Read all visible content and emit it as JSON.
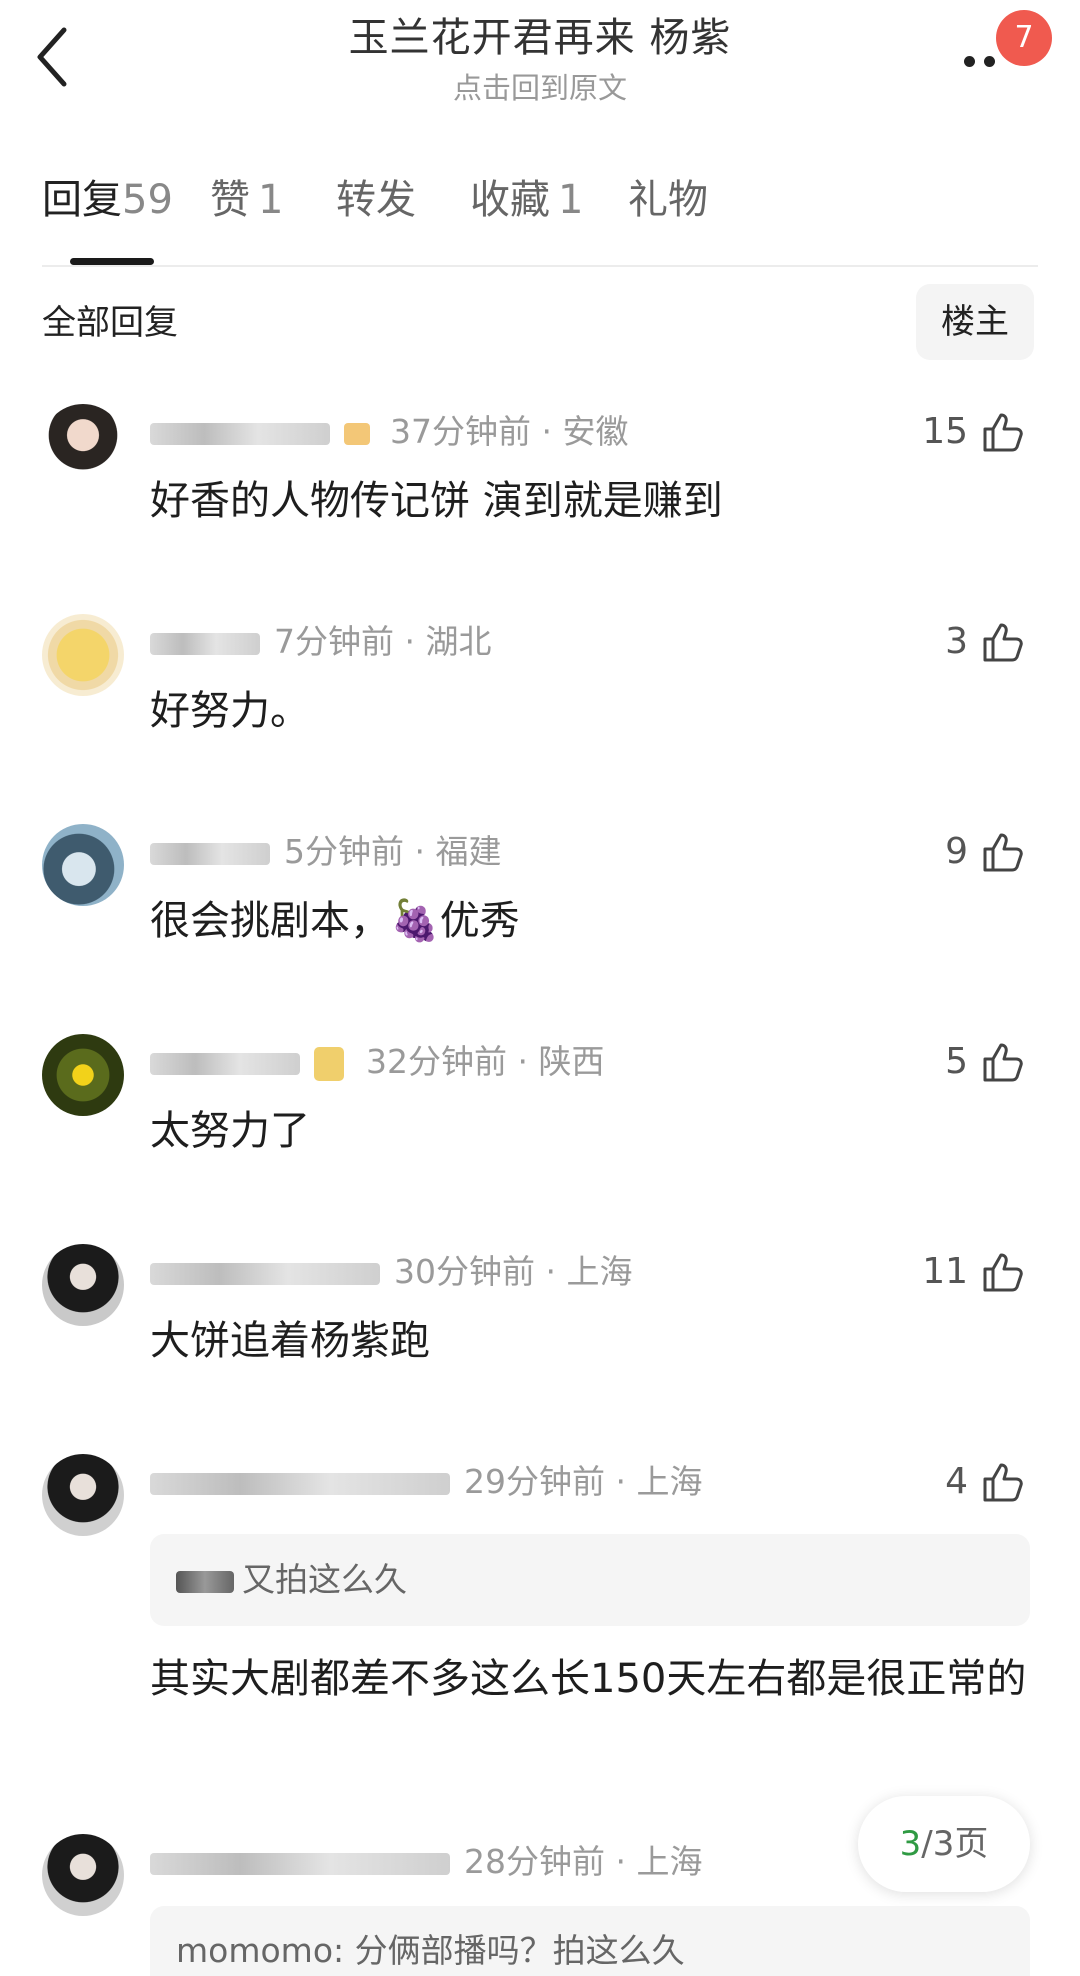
{
  "header": {
    "title": "玉兰花开君再来 杨紫",
    "subtitle": "点击回到原文",
    "badge_count": "7"
  },
  "tabs": [
    {
      "label": "回复",
      "count": "59"
    },
    {
      "label": "赞",
      "count": "1"
    },
    {
      "label": "转发",
      "count": ""
    },
    {
      "label": "收藏",
      "count": "1"
    },
    {
      "label": "礼物",
      "count": ""
    }
  ],
  "filter": {
    "label": "全部回复",
    "op_button": "楼主"
  },
  "comments": [
    {
      "time": "37分钟前",
      "sep": "·",
      "location": "安徽",
      "likes": "15",
      "text": "好香的人物传记饼 演到就是赚到"
    },
    {
      "time": "7分钟前",
      "sep": "·",
      "location": "湖北",
      "likes": "3",
      "text": "好努力。"
    },
    {
      "time": "5分钟前",
      "sep": "·",
      "location": "福建",
      "likes": "9",
      "text": "很会挑剧本，🍇优秀"
    },
    {
      "time": "32分钟前",
      "sep": "·",
      "location": "陕西",
      "likes": "5",
      "text": "太努力了"
    },
    {
      "time": "30分钟前",
      "sep": "·",
      "location": "上海",
      "likes": "11",
      "text": "大饼追着杨紫跑"
    },
    {
      "time": "29分钟前",
      "sep": "·",
      "location": "上海",
      "likes": "4",
      "quote": "又拍这么久",
      "text": "其实大剧都差不多这么长150天左右都是很正常的"
    },
    {
      "time": "28分钟前",
      "sep": "·",
      "location": "上海",
      "likes": "",
      "quote": "momomo: 分俩部播吗？拍这么久"
    }
  ],
  "pager": {
    "current": "3",
    "rest": "/3页"
  },
  "colors": {
    "accent_green": "#2f9a43",
    "badge_red": "#f05a4f"
  },
  "icons": [
    "back-arrow-icon",
    "more-dots-icon",
    "thumbs-up-icon"
  ]
}
